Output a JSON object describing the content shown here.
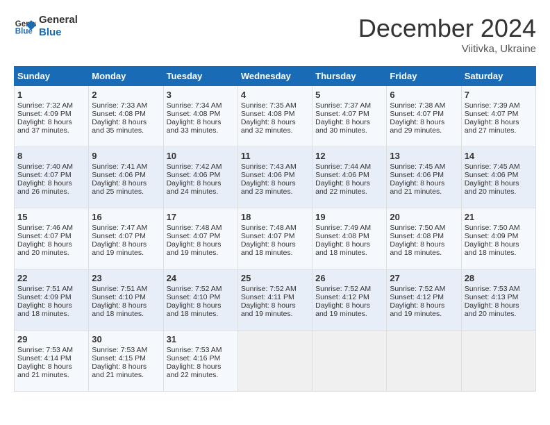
{
  "header": {
    "logo_line1": "General",
    "logo_line2": "Blue",
    "month": "December 2024",
    "location": "Viitivka, Ukraine"
  },
  "days_of_week": [
    "Sunday",
    "Monday",
    "Tuesday",
    "Wednesday",
    "Thursday",
    "Friday",
    "Saturday"
  ],
  "weeks": [
    [
      {
        "day": 1,
        "lines": [
          "Sunrise: 7:32 AM",
          "Sunset: 4:09 PM",
          "Daylight: 8 hours",
          "and 37 minutes."
        ]
      },
      {
        "day": 2,
        "lines": [
          "Sunrise: 7:33 AM",
          "Sunset: 4:08 PM",
          "Daylight: 8 hours",
          "and 35 minutes."
        ]
      },
      {
        "day": 3,
        "lines": [
          "Sunrise: 7:34 AM",
          "Sunset: 4:08 PM",
          "Daylight: 8 hours",
          "and 33 minutes."
        ]
      },
      {
        "day": 4,
        "lines": [
          "Sunrise: 7:35 AM",
          "Sunset: 4:08 PM",
          "Daylight: 8 hours",
          "and 32 minutes."
        ]
      },
      {
        "day": 5,
        "lines": [
          "Sunrise: 7:37 AM",
          "Sunset: 4:07 PM",
          "Daylight: 8 hours",
          "and 30 minutes."
        ]
      },
      {
        "day": 6,
        "lines": [
          "Sunrise: 7:38 AM",
          "Sunset: 4:07 PM",
          "Daylight: 8 hours",
          "and 29 minutes."
        ]
      },
      {
        "day": 7,
        "lines": [
          "Sunrise: 7:39 AM",
          "Sunset: 4:07 PM",
          "Daylight: 8 hours",
          "and 27 minutes."
        ]
      }
    ],
    [
      {
        "day": 8,
        "lines": [
          "Sunrise: 7:40 AM",
          "Sunset: 4:07 PM",
          "Daylight: 8 hours",
          "and 26 minutes."
        ]
      },
      {
        "day": 9,
        "lines": [
          "Sunrise: 7:41 AM",
          "Sunset: 4:06 PM",
          "Daylight: 8 hours",
          "and 25 minutes."
        ]
      },
      {
        "day": 10,
        "lines": [
          "Sunrise: 7:42 AM",
          "Sunset: 4:06 PM",
          "Daylight: 8 hours",
          "and 24 minutes."
        ]
      },
      {
        "day": 11,
        "lines": [
          "Sunrise: 7:43 AM",
          "Sunset: 4:06 PM",
          "Daylight: 8 hours",
          "and 23 minutes."
        ]
      },
      {
        "day": 12,
        "lines": [
          "Sunrise: 7:44 AM",
          "Sunset: 4:06 PM",
          "Daylight: 8 hours",
          "and 22 minutes."
        ]
      },
      {
        "day": 13,
        "lines": [
          "Sunrise: 7:45 AM",
          "Sunset: 4:06 PM",
          "Daylight: 8 hours",
          "and 21 minutes."
        ]
      },
      {
        "day": 14,
        "lines": [
          "Sunrise: 7:45 AM",
          "Sunset: 4:06 PM",
          "Daylight: 8 hours",
          "and 20 minutes."
        ]
      }
    ],
    [
      {
        "day": 15,
        "lines": [
          "Sunrise: 7:46 AM",
          "Sunset: 4:07 PM",
          "Daylight: 8 hours",
          "and 20 minutes."
        ]
      },
      {
        "day": 16,
        "lines": [
          "Sunrise: 7:47 AM",
          "Sunset: 4:07 PM",
          "Daylight: 8 hours",
          "and 19 minutes."
        ]
      },
      {
        "day": 17,
        "lines": [
          "Sunrise: 7:48 AM",
          "Sunset: 4:07 PM",
          "Daylight: 8 hours",
          "and 19 minutes."
        ]
      },
      {
        "day": 18,
        "lines": [
          "Sunrise: 7:48 AM",
          "Sunset: 4:07 PM",
          "Daylight: 8 hours",
          "and 18 minutes."
        ]
      },
      {
        "day": 19,
        "lines": [
          "Sunrise: 7:49 AM",
          "Sunset: 4:08 PM",
          "Daylight: 8 hours",
          "and 18 minutes."
        ]
      },
      {
        "day": 20,
        "lines": [
          "Sunrise: 7:50 AM",
          "Sunset: 4:08 PM",
          "Daylight: 8 hours",
          "and 18 minutes."
        ]
      },
      {
        "day": 21,
        "lines": [
          "Sunrise: 7:50 AM",
          "Sunset: 4:09 PM",
          "Daylight: 8 hours",
          "and 18 minutes."
        ]
      }
    ],
    [
      {
        "day": 22,
        "lines": [
          "Sunrise: 7:51 AM",
          "Sunset: 4:09 PM",
          "Daylight: 8 hours",
          "and 18 minutes."
        ]
      },
      {
        "day": 23,
        "lines": [
          "Sunrise: 7:51 AM",
          "Sunset: 4:10 PM",
          "Daylight: 8 hours",
          "and 18 minutes."
        ]
      },
      {
        "day": 24,
        "lines": [
          "Sunrise: 7:52 AM",
          "Sunset: 4:10 PM",
          "Daylight: 8 hours",
          "and 18 minutes."
        ]
      },
      {
        "day": 25,
        "lines": [
          "Sunrise: 7:52 AM",
          "Sunset: 4:11 PM",
          "Daylight: 8 hours",
          "and 19 minutes."
        ]
      },
      {
        "day": 26,
        "lines": [
          "Sunrise: 7:52 AM",
          "Sunset: 4:12 PM",
          "Daylight: 8 hours",
          "and 19 minutes."
        ]
      },
      {
        "day": 27,
        "lines": [
          "Sunrise: 7:52 AM",
          "Sunset: 4:12 PM",
          "Daylight: 8 hours",
          "and 19 minutes."
        ]
      },
      {
        "day": 28,
        "lines": [
          "Sunrise: 7:53 AM",
          "Sunset: 4:13 PM",
          "Daylight: 8 hours",
          "and 20 minutes."
        ]
      }
    ],
    [
      {
        "day": 29,
        "lines": [
          "Sunrise: 7:53 AM",
          "Sunset: 4:14 PM",
          "Daylight: 8 hours",
          "and 21 minutes."
        ]
      },
      {
        "day": 30,
        "lines": [
          "Sunrise: 7:53 AM",
          "Sunset: 4:15 PM",
          "Daylight: 8 hours",
          "and 21 minutes."
        ]
      },
      {
        "day": 31,
        "lines": [
          "Sunrise: 7:53 AM",
          "Sunset: 4:16 PM",
          "Daylight: 8 hours",
          "and 22 minutes."
        ]
      },
      null,
      null,
      null,
      null
    ]
  ]
}
